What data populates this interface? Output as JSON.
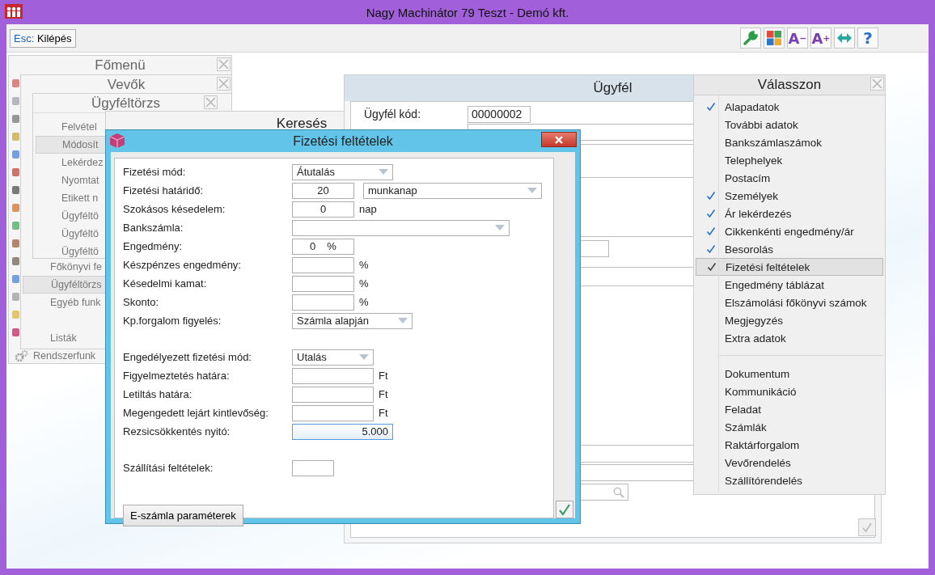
{
  "window": {
    "title": "Nagy Machinátor 79 Teszt - Demó kft."
  },
  "toolbar": {
    "exit_button": {
      "key": "Esc:",
      "label": "Kilépés"
    },
    "icon_buttons": [
      {
        "kind": "wrench"
      },
      {
        "kind": "tiles"
      },
      {
        "kind": "font-smaller",
        "glyph": "A",
        "sign": "−"
      },
      {
        "kind": "font-larger",
        "glyph": "A",
        "sign": "+"
      },
      {
        "kind": "arrows"
      },
      {
        "kind": "help",
        "glyph": "?"
      }
    ]
  },
  "main_menu": {
    "title": "Főmenü",
    "items": [
      {
        "label": "Rendszerfunk",
        "selected": false
      }
    ]
  },
  "customers_window": {
    "title": "Vevők",
    "items": [
      {
        "label": "Főkönyvi fe",
        "selected": false
      },
      {
        "label": "Ügyféltörzs",
        "selected": true
      },
      {
        "label": "Egyéb funk",
        "selected": false
      },
      {
        "label": "Listák",
        "selected": false
      }
    ]
  },
  "customer_master_window": {
    "title": "Ügyféltörzs",
    "items": [
      {
        "label": "Felvétel",
        "selected": false
      },
      {
        "label": "Módosít",
        "selected": true
      },
      {
        "label": "Lekérdez",
        "selected": false
      },
      {
        "label": "Nyomtat",
        "selected": false
      },
      {
        "label": "Etikett n",
        "selected": false
      },
      {
        "label": "Ügyféltö",
        "selected": false
      },
      {
        "label": "Ügyféltö",
        "selected": false
      },
      {
        "label": "Ügyféltö",
        "selected": false
      }
    ]
  },
  "search_window": {
    "title": "Keresés"
  },
  "customer_window": {
    "title": "Ügyfél",
    "code_label": "Ügyfél kód:",
    "code_value": "00000002"
  },
  "choose_menu": {
    "title": "Válasszon",
    "groups": [
      {
        "items": [
          {
            "label": "Alapadatok",
            "checked": true,
            "selected": false
          },
          {
            "label": "További adatok",
            "checked": false,
            "selected": false
          },
          {
            "label": "Bankszámlaszámok",
            "checked": false,
            "selected": false
          },
          {
            "label": "Telephelyek",
            "checked": false,
            "selected": false
          },
          {
            "label": "Postacím",
            "checked": false,
            "selected": false
          },
          {
            "label": "Személyek",
            "checked": true,
            "selected": false
          },
          {
            "label": "Ár lekérdezés",
            "checked": true,
            "selected": false
          },
          {
            "label": "Cikkenkénti engedmény/ár",
            "checked": true,
            "selected": false
          },
          {
            "label": "Besorolás",
            "checked": true,
            "selected": false
          },
          {
            "label": "Fizetési feltételek",
            "checked": true,
            "selected": true
          },
          {
            "label": "Engedmény táblázat",
            "checked": false,
            "selected": false
          },
          {
            "label": "Elszámolási főkönyvi számok",
            "checked": false,
            "selected": false
          },
          {
            "label": "Megjegyzés",
            "checked": false,
            "selected": false
          },
          {
            "label": "Extra adatok",
            "checked": false,
            "selected": false
          }
        ]
      },
      {
        "items": [
          {
            "label": "Dokumentum",
            "checked": false,
            "selected": false
          },
          {
            "label": "Kommunikáció",
            "checked": false,
            "selected": false
          },
          {
            "label": "Feladat",
            "checked": false,
            "selected": false
          },
          {
            "label": "Számlák",
            "checked": false,
            "selected": false
          },
          {
            "label": "Raktárforgalom",
            "checked": false,
            "selected": false
          },
          {
            "label": "Vevőrendelés",
            "checked": false,
            "selected": false
          },
          {
            "label": "Szállítórendelés",
            "checked": false,
            "selected": false
          }
        ]
      }
    ]
  },
  "dialog": {
    "title": "Fizetési feltételek",
    "sections": [
      {
        "fields": [
          {
            "label": "Fizetési mód:",
            "focused": false,
            "controls": [
              {
                "kind": "dropdown",
                "value": "Átutalás"
              }
            ]
          },
          {
            "label": "Fizetési határidő:",
            "focused": false,
            "controls": [
              {
                "kind": "number",
                "value": "20"
              },
              {
                "kind": "dropdown",
                "value": "munkanap"
              }
            ]
          },
          {
            "label": "Szokásos késedelem:",
            "focused": false,
            "controls": [
              {
                "kind": "number",
                "value": "0"
              }
            ],
            "unit": "nap"
          },
          {
            "label": "Bankszámla:",
            "focused": false,
            "controls": [
              {
                "kind": "dropdown"
              }
            ]
          },
          {
            "label": "Engedmény:",
            "focused": false,
            "controls": [
              {
                "kind": "number",
                "value": "0",
                "suffix": "%"
              }
            ]
          },
          {
            "label": "Készpénzes engedmény:",
            "focused": false,
            "controls": [
              {
                "kind": "number"
              }
            ],
            "unit": "%"
          },
          {
            "label": "Késedelmi kamat:",
            "focused": false,
            "controls": [
              {
                "kind": "number"
              }
            ],
            "unit": "%"
          },
          {
            "label": "Skonto:",
            "focused": false,
            "controls": [
              {
                "kind": "number"
              }
            ],
            "unit": "%"
          },
          {
            "label": "Kp.forgalom figyelés:",
            "focused": false,
            "controls": [
              {
                "kind": "dropdown",
                "value": "Számla alapján"
              }
            ]
          }
        ]
      },
      {
        "fields": [
          {
            "label": "Engedélyezett fizetési mód:",
            "focused": false,
            "controls": [
              {
                "kind": "dropdown",
                "value": "Utalás"
              }
            ]
          },
          {
            "label": "Figyelmeztetés határa:",
            "focused": false,
            "controls": [
              {
                "kind": "amount"
              }
            ],
            "unit": "Ft"
          },
          {
            "label": "Letiltás határa:",
            "focused": false,
            "controls": [
              {
                "kind": "amount"
              }
            ],
            "unit": "Ft"
          },
          {
            "label": "Megengedett lejárt kintlevőség:",
            "focused": false,
            "controls": [
              {
                "kind": "amount"
              }
            ],
            "unit": "Ft"
          },
          {
            "label": "Rezsicsökkentés nyitó:",
            "focused": true,
            "controls": [
              {
                "kind": "amount",
                "value": "5.000"
              }
            ]
          }
        ]
      },
      {
        "fields": [
          {
            "label": "Szállítási feltételek:",
            "focused": false,
            "controls": [
              {
                "kind": "number"
              }
            ]
          }
        ]
      }
    ],
    "button": "E-számla paraméterek"
  }
}
